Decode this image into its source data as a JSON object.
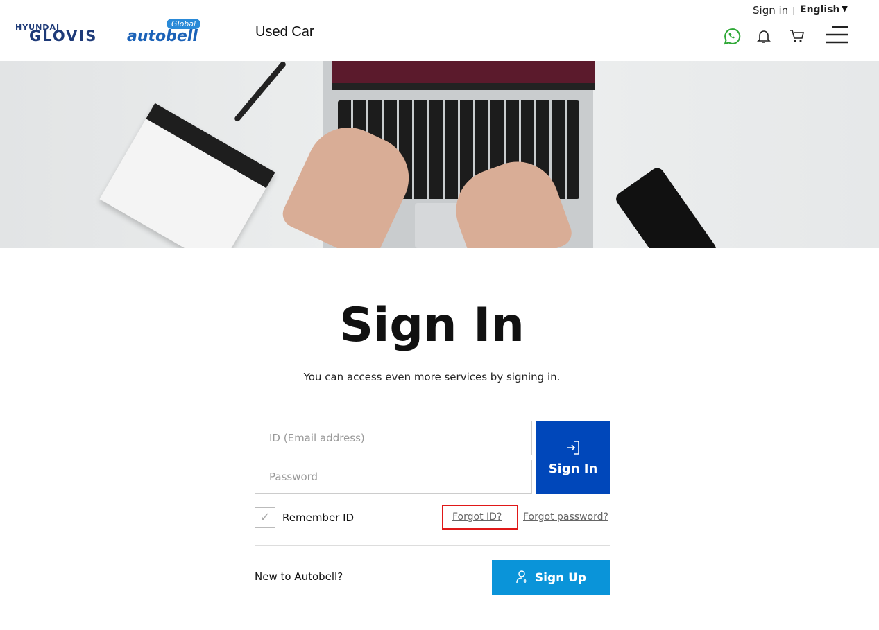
{
  "header": {
    "logo": {
      "brand_top": "HYUNDAI",
      "brand_main": "GLOVIS",
      "product": "autobell",
      "badge": "Global"
    },
    "section": "Used Car",
    "sign_in": "Sign in",
    "language": "English",
    "icons": [
      "whatsapp-icon",
      "bell-icon",
      "cart-icon",
      "menu-icon"
    ],
    "whatsapp_color": "#2ea836"
  },
  "main": {
    "title": "Sign In",
    "subtitle": "You can access even more services by signing in.",
    "id_placeholder": "ID (Email address)",
    "password_placeholder": "Password",
    "sign_in_button": "Sign In",
    "remember_id": "Remember ID",
    "remember_checked": false,
    "forgot_id": "Forgot ID?",
    "forgot_password": "Forgot password?",
    "new_to": "New to Autobell?",
    "sign_up_button": "Sign Up",
    "colors": {
      "sign_in": "#0047ba",
      "sign_up": "#0a94d9",
      "highlight": "#e01818"
    }
  }
}
